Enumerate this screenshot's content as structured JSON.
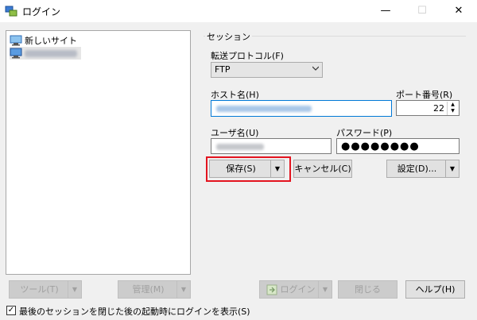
{
  "window": {
    "title": "ログイン",
    "minimize": "—",
    "maximize": "☐",
    "close": "✕"
  },
  "sites": [
    {
      "label": "新しいサイト"
    }
  ],
  "session": {
    "group_label": "セッション",
    "protocol_label": "転送プロトコル(F)",
    "protocol_value": "FTP",
    "host_label": "ホスト名(H)",
    "port_label": "ポート番号(R)",
    "port_value": "22",
    "user_label": "ユーザ名(U)",
    "password_label": "パスワード(P)",
    "password_value": "●●●●●●●●"
  },
  "buttons": {
    "save": "保存(S)",
    "cancel": "キャンセル(C)",
    "settings": "設定(D)...",
    "tools": "ツール(T)",
    "manage": "管理(M)",
    "login": "ログイン",
    "close": "閉じる",
    "help": "ヘルプ(H)",
    "split_arrow": "▼"
  },
  "options": {
    "show_login_on_startup": "最後のセッションを閉じた後の起動時にログインを表示(S)",
    "show_login_checked": true
  },
  "colors": {
    "highlight": "#e3141f",
    "focus": "#0078d7"
  }
}
